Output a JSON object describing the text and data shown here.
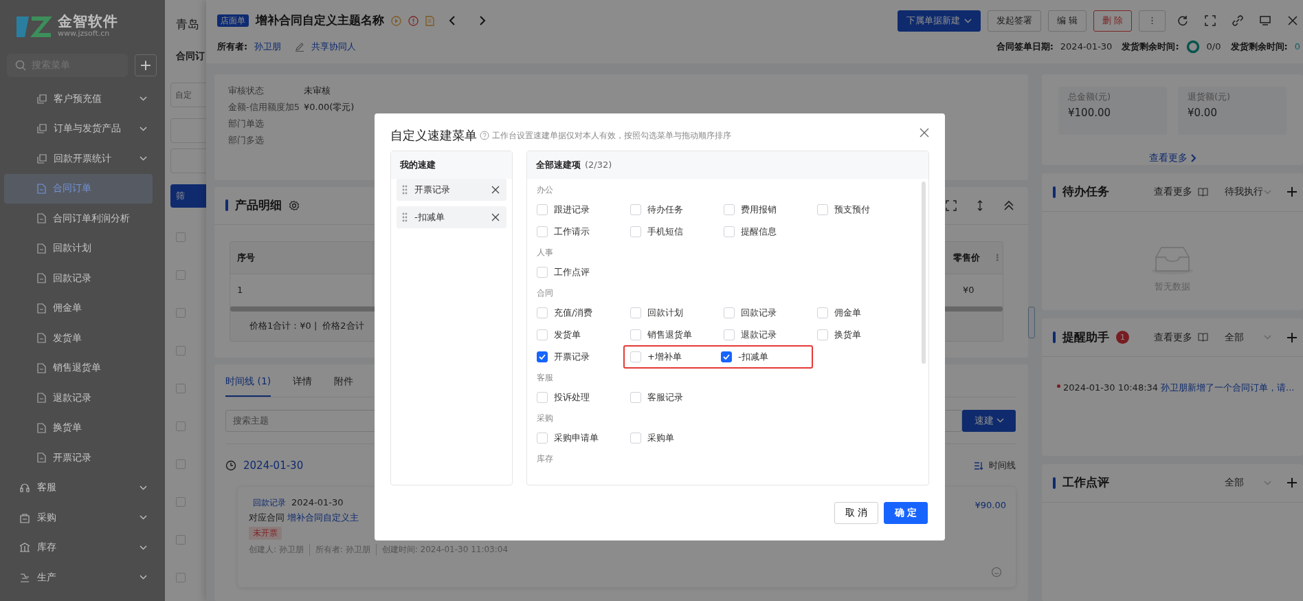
{
  "sidebar": {
    "logo": {
      "name": "金智软件",
      "url": "www.jzsoft.cn"
    },
    "search": {
      "placeholder": "搜索菜单"
    },
    "add_button": "+",
    "items": [
      {
        "label": "客户预充值",
        "kind": "group",
        "selected": false
      },
      {
        "label": "订单与发货产品",
        "kind": "group",
        "selected": false
      },
      {
        "label": "回款开票统计",
        "kind": "group",
        "selected": false
      },
      {
        "label": "合同订单",
        "kind": "page",
        "selected": true
      },
      {
        "label": "合同订单利润分析",
        "kind": "page",
        "selected": false
      },
      {
        "label": "回款计划",
        "kind": "page",
        "selected": false
      },
      {
        "label": "回款记录",
        "kind": "page",
        "selected": false
      },
      {
        "label": "佣金单",
        "kind": "page",
        "selected": false
      },
      {
        "label": "发货单",
        "kind": "page",
        "selected": false
      },
      {
        "label": "销售退货单",
        "kind": "page",
        "selected": false
      },
      {
        "label": "退款记录",
        "kind": "page",
        "selected": false
      },
      {
        "label": "换货单",
        "kind": "page",
        "selected": false
      },
      {
        "label": "开票记录",
        "kind": "page",
        "selected": false
      },
      {
        "label": "客服",
        "kind": "module",
        "selected": false
      },
      {
        "label": "采购",
        "kind": "module",
        "selected": false
      },
      {
        "label": "库存",
        "kind": "module",
        "selected": false
      },
      {
        "label": "生产",
        "kind": "module",
        "selected": false
      }
    ]
  },
  "list_page": {
    "title": "青岛",
    "heading": "合同订",
    "filter_placeholder": "自定",
    "filter_button": "筛",
    "rows": [
      {
        "checked": false
      },
      {
        "checked": false
      },
      {
        "checked": false
      },
      {
        "checked": false
      },
      {
        "checked": false
      },
      {
        "checked": false
      },
      {
        "checked": false
      },
      {
        "checked": false
      },
      {
        "checked": false
      },
      {
        "checked": false
      }
    ]
  },
  "drawer": {
    "type_badge": "店面单",
    "title": "增补合同自定义主题名称",
    "owner_label": "所有者:",
    "owner": "孙卫朋",
    "share": "共享协同人",
    "actions": [
      {
        "label": "下属单据新建",
        "kind": "primary"
      },
      {
        "label": "发起签署",
        "kind": "default"
      },
      {
        "label": "编 辑",
        "kind": "default"
      },
      {
        "label": "删 除",
        "kind": "danger"
      }
    ],
    "more_button": "⋮",
    "meta": [
      {
        "label": "合同签单日期:",
        "value": "2024-01-30",
        "kind": "text"
      },
      {
        "label": "发货剩余时间:",
        "value": "0/0",
        "kind": "ring"
      },
      {
        "label": "发货剩余时间:",
        "value": "0",
        "kind": "text"
      }
    ]
  },
  "info": {
    "fields": [
      {
        "label": "审核状态",
        "value": "未审核"
      },
      {
        "label": "金额-信用额度加5",
        "value": "¥0.00(零元)"
      },
      {
        "label": "部门单选"
      },
      {
        "label": "部门多选"
      }
    ]
  },
  "products": {
    "title": "产品明细",
    "columns": [
      "序号",
      "零售价"
    ],
    "column_menu": "⋮",
    "rows": [
      [
        "1",
        "¥0"
      ]
    ],
    "totals": [
      "价格1合计：¥0 |",
      "价格2合计"
    ]
  },
  "activity": {
    "tabs": [
      {
        "label": "时间线 (1)",
        "selected": true
      },
      {
        "label": "详情",
        "selected": false
      },
      {
        "label": "附件",
        "selected": false
      }
    ],
    "search_placeholder": "搜索主题",
    "quick_button": "速建",
    "date": "2024-01-30",
    "view_toggle": "时间线",
    "entry": {
      "type": "回款记录",
      "date": "2024-01-30",
      "contract_label": "对应合同",
      "contract": "增补合同自定义主",
      "tag": "未开票",
      "meta": [
        "创建人: 孙卫朋",
        "所有者: 孙卫朋",
        "创建时间: 2024-01-30 11:03:04"
      ],
      "amount": "¥90.00"
    }
  },
  "summary": {
    "stats": [
      {
        "label": "总金额(元)",
        "value": "¥100.00"
      },
      {
        "label": "退货额(元)",
        "value": "¥0.00"
      }
    ],
    "more": "查看更多"
  },
  "panels": [
    {
      "title": "待办任务",
      "more": "查看更多",
      "filter": "待我执行",
      "empty": "暂无数据"
    },
    {
      "title": "提醒助手",
      "badge": "1",
      "more": "查看更多",
      "filter": "全部",
      "entries": [
        {
          "time": "2024-01-30 10:48:34",
          "text": "孙卫朋新增了一个合同订单，请..."
        }
      ]
    },
    {
      "title": "工作点评",
      "filter": "全部"
    }
  ],
  "modal": {
    "title": "自定义速建菜单",
    "hint": "工作台设置速建单据仅对本人有效，按照勾选菜单与拖动顺序排序",
    "my_title": "我的速建",
    "my_items": [
      "开票记录",
      "-扣减单"
    ],
    "all_title": "全部速建项",
    "count": "(2/32)",
    "groups": [
      {
        "name": "办公",
        "items": [
          {
            "label": "跟进记录",
            "checked": false,
            "highlighted": false
          },
          {
            "label": "待办任务",
            "checked": false,
            "highlighted": false
          },
          {
            "label": "费用报销",
            "checked": false,
            "highlighted": false
          },
          {
            "label": "预支预付",
            "checked": false,
            "highlighted": false
          },
          {
            "label": "工作请示",
            "checked": false,
            "highlighted": false
          },
          {
            "label": "手机短信",
            "checked": false,
            "highlighted": false
          },
          {
            "label": "提醒信息",
            "checked": false,
            "highlighted": false
          }
        ]
      },
      {
        "name": "人事",
        "items": [
          {
            "label": "工作点评",
            "checked": false,
            "highlighted": false
          }
        ]
      },
      {
        "name": "合同",
        "items": [
          {
            "label": "充值/消费",
            "checked": false,
            "highlighted": false
          },
          {
            "label": "回款计划",
            "checked": false,
            "highlighted": false
          },
          {
            "label": "回款记录",
            "checked": false,
            "highlighted": false
          },
          {
            "label": "佣金单",
            "checked": false,
            "highlighted": false
          },
          {
            "label": "发货单",
            "checked": false,
            "highlighted": false
          },
          {
            "label": "销售退货单",
            "checked": false,
            "highlighted": false
          },
          {
            "label": "退款记录",
            "checked": false,
            "highlighted": false
          },
          {
            "label": "换货单",
            "checked": false,
            "highlighted": false
          },
          {
            "label": "开票记录",
            "checked": true,
            "highlighted": false
          },
          {
            "label": "+增补单",
            "checked": false,
            "highlighted": true
          },
          {
            "label": "-扣减单",
            "checked": true,
            "highlighted": true
          }
        ]
      },
      {
        "name": "客服",
        "items": [
          {
            "label": "投诉处理",
            "checked": false,
            "highlighted": false
          },
          {
            "label": "客服记录",
            "checked": false,
            "highlighted": false
          }
        ]
      },
      {
        "name": "采购",
        "items": [
          {
            "label": "采购申请单",
            "checked": false,
            "highlighted": false
          },
          {
            "label": "采购单",
            "checked": false,
            "highlighted": false
          }
        ]
      },
      {
        "name": "库存"
      }
    ],
    "cancel": "取 消",
    "ok": "确 定"
  }
}
